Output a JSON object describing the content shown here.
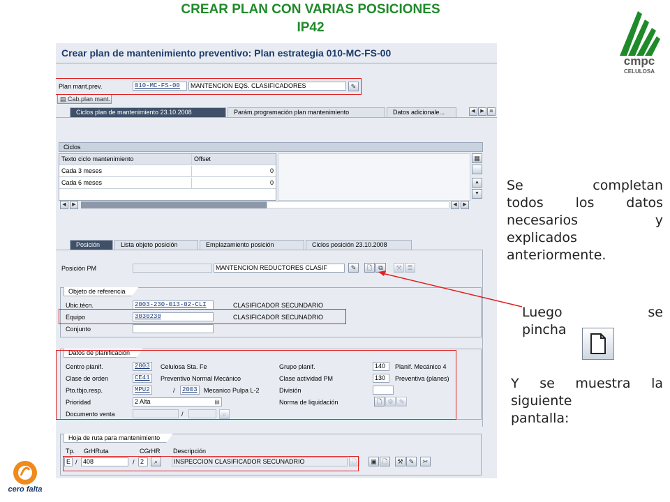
{
  "slide": {
    "title_line1": "CREAR PLAN CON VARIAS POSICIONES",
    "title_line2": "IP42",
    "notes": {
      "completan_words": [
        "Se",
        "completan"
      ],
      "completan_line2": [
        "todos",
        "los",
        "datos"
      ],
      "completan_line3": [
        "necesarios",
        "y"
      ],
      "completan_line4": "explicados",
      "completan_line5": "anteriormente.",
      "luego_words": [
        "Luego",
        "se"
      ],
      "pincha": "pincha",
      "muestra_words": [
        "Y",
        "se",
        "muestra",
        "la"
      ],
      "muestra_line2": "siguiente",
      "muestra_line3": "pantalla:"
    },
    "brand_cmpc": "cmpc",
    "brand_celulosa": "CELULOSA",
    "brand_cero_falta": "cero falta",
    "accent_green": "#1f8a2a",
    "annotation_red": "#e02020"
  },
  "sap": {
    "screen_title": "Crear plan de mantenimiento preventivo: Plan estrategia 010-MC-FS-00",
    "plan_label": "Plan mant.prev.",
    "plan_id": "010-MC-FS-00",
    "plan_desc": "MANTENCION EQS. CLASIFICADORES",
    "cab_button": "Cab.plan mant.",
    "top_tabs": [
      "Ciclos plan de mantenimiento 23.10.2008",
      "Parám.programación plan mantenimiento",
      "Datos adicionale..."
    ],
    "ciclos": {
      "title": "Ciclos",
      "headers": [
        "Texto ciclo mantenimiento",
        "Offset"
      ],
      "rows": [
        {
          "text": "Cada 3 meses",
          "offset": "0"
        },
        {
          "text": "Cada 6 meses",
          "offset": "0"
        }
      ]
    },
    "bottom_tabs": [
      "Posición",
      "Lista objeto posición",
      "Emplazamiento posición",
      "Ciclos posición 23.10.2008"
    ],
    "posicion_pm_label": "Posición PM",
    "posicion_pm_value": "",
    "posicion_pm_desc": "MANTENCION REDUCTORES CLASIF",
    "objeto_ref": {
      "title": "Objeto de referencia",
      "ubic_label": "Ubic.técn.",
      "ubic_value": "2003-230-013-02-CLI",
      "ubic_desc": "CLASIFICADOR SECUNDARIO",
      "equipo_label": "Equipo",
      "equipo_value": "3030230",
      "equipo_desc": "CLASIFICADOR SECUNADRIO",
      "conjunto_label": "Conjunto"
    },
    "planif": {
      "title": "Datos de planificación",
      "centro_label": "Centro planif.",
      "centro_value": "2003",
      "centro_desc": "Celulosa Sta. Fe",
      "grupo_label": "Grupo planif.",
      "grupo_value": "140",
      "grupo_desc": "Planif. Mecánico 4",
      "clase_orden_label": "Clase de orden",
      "clase_orden_value": "CE41",
      "clase_orden_desc": "Preventivo Normal Mecánico",
      "clase_act_label": "Clase actividad PM",
      "clase_act_value": "130",
      "clase_act_desc": "Preventiva (planes)",
      "pto_label": "Pto.tbjo.resp.",
      "pto_value": "MPU2",
      "pto_value2": "2003",
      "pto_desc": "Mecanico Pulpa L-2",
      "slash": "/",
      "division_label": "División",
      "prioridad_label": "Prioridad",
      "prioridad_value": "2 Alta",
      "norma_label": "Norma de liquidación",
      "doc_venta_label": "Documento venta"
    },
    "hoja_ruta": {
      "title": "Hoja de ruta para mantenimiento",
      "headers": [
        "Tp.",
        "GrHRuta",
        "CGrHR",
        "Descripción"
      ],
      "tp": "E",
      "grhruta": "408",
      "cgrhr": "2",
      "descripcion": "INSPECCION CLASIFICADOR SECUNADRIO"
    }
  }
}
